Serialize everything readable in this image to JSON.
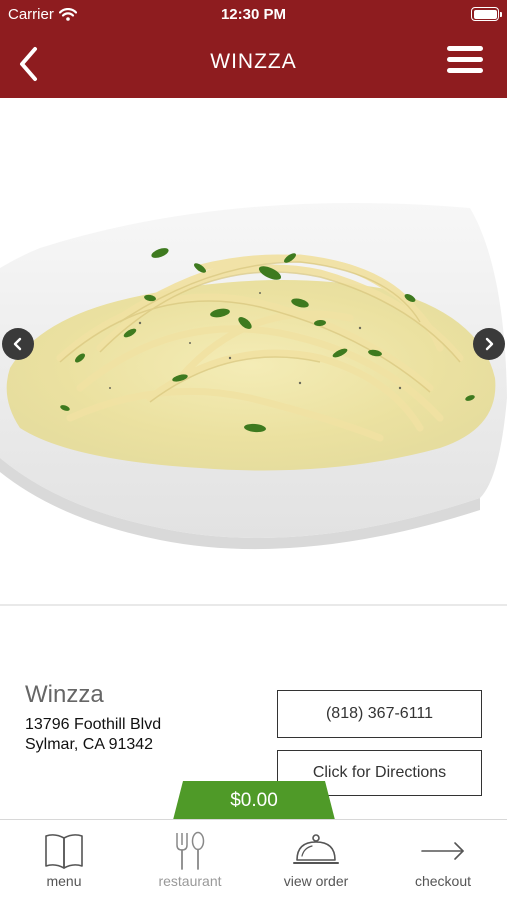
{
  "status_bar": {
    "carrier": "Carrier",
    "time": "12:30 PM"
  },
  "header": {
    "title": "WINZZA",
    "color": "#8e1c1f"
  },
  "hero": {
    "image": "fettuccine-alfredo-photo"
  },
  "restaurant": {
    "name": "Winzza",
    "address_line1": "13796 Foothill Blvd",
    "address_line2": "Sylmar, CA 91342",
    "phone": "(818) 367-6111",
    "directions_label": "Click for Directions"
  },
  "order": {
    "total": "$0.00",
    "accent_color": "#4f9a28"
  },
  "tabbar": {
    "tabs": [
      {
        "label": "menu",
        "icon": "book-icon"
      },
      {
        "label": "restaurant",
        "icon": "fork-knife-icon"
      },
      {
        "label": "view order",
        "icon": "cloche-icon"
      },
      {
        "label": "checkout",
        "icon": "arrow-right-icon"
      }
    ]
  }
}
